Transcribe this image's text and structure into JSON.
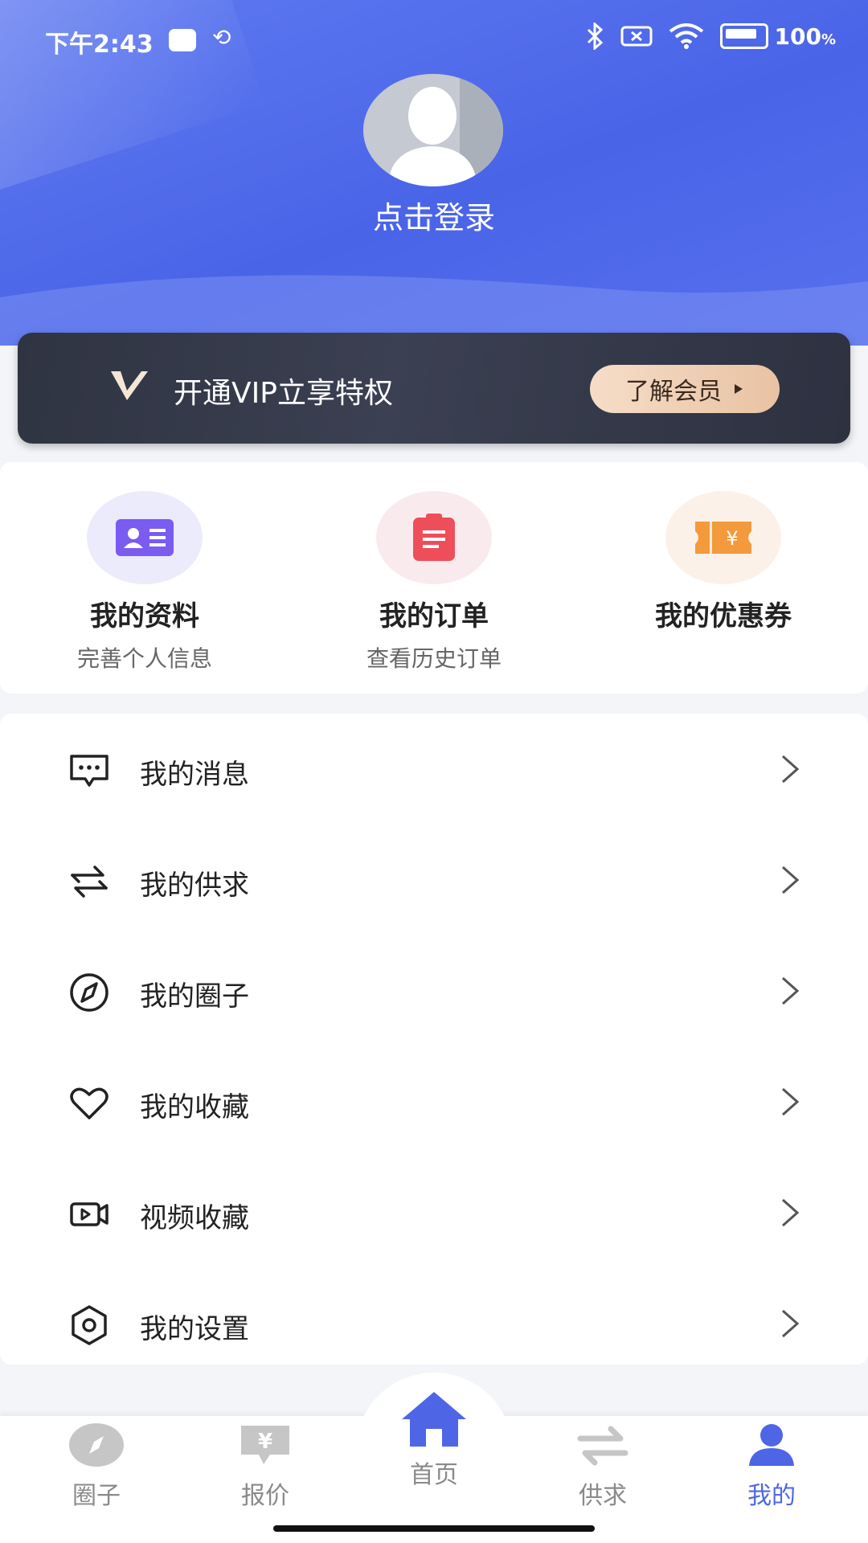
{
  "status_bar": {
    "time": "下午2:43",
    "battery": "100",
    "battery_unit": "%"
  },
  "profile": {
    "login_label": "点击登录"
  },
  "vip": {
    "text": "开通VIP立享特权",
    "button_label": "了解会员"
  },
  "quick_actions": [
    {
      "title": "我的资料",
      "subtitle": "完善个人信息",
      "icon": "profile-card-icon",
      "color": "#7a5cf0",
      "bg": "#ecebfb"
    },
    {
      "title": "我的订单",
      "subtitle": "查看历史订单",
      "icon": "clipboard-icon",
      "color": "#ee4e5a",
      "bg": "#f9ebed"
    },
    {
      "title": "我的优惠券",
      "subtitle": "",
      "icon": "ticket-icon",
      "color": "#f39a3c",
      "bg": "#fcf1e8"
    }
  ],
  "menu": [
    {
      "label": "我的消息",
      "icon": "message-icon"
    },
    {
      "label": "我的供求",
      "icon": "exchange-icon"
    },
    {
      "label": "我的圈子",
      "icon": "compass-icon"
    },
    {
      "label": "我的收藏",
      "icon": "heart-icon"
    },
    {
      "label": "视频收藏",
      "icon": "video-icon"
    },
    {
      "label": "我的设置",
      "icon": "settings-icon"
    }
  ],
  "bottom_nav": [
    {
      "label": "圈子",
      "icon": "compass-icon"
    },
    {
      "label": "报价",
      "icon": "yen-chat-icon"
    },
    {
      "label": "首页",
      "icon": "home-icon"
    },
    {
      "label": "供求",
      "icon": "exchange-icon"
    },
    {
      "label": "我的",
      "icon": "user-icon",
      "active": true
    }
  ],
  "colors": {
    "header": "#4a64e8",
    "accent": "#4e66e6"
  }
}
